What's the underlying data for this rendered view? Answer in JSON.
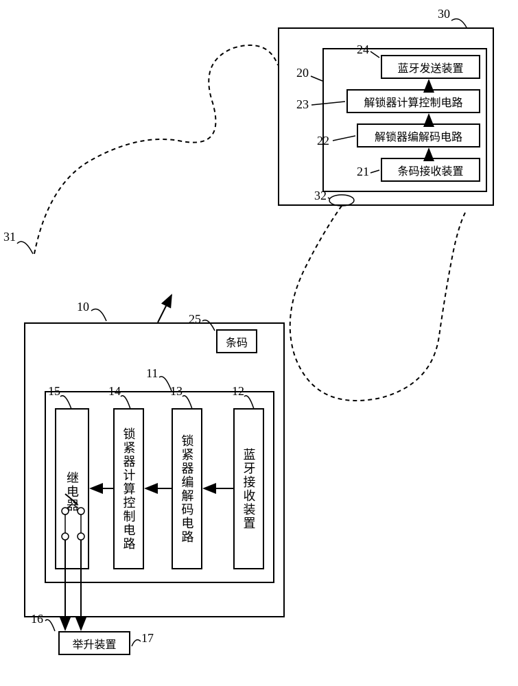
{
  "diagram": {
    "topRight": {
      "outerLabel": "30",
      "innerLabel": "20",
      "box24": {
        "num": "24",
        "text": "蓝牙发送装置"
      },
      "box23": {
        "num": "23",
        "text": "解锁器计算控制电路"
      },
      "box22": {
        "num": "22",
        "text": "解锁器编解码电路"
      },
      "box21": {
        "num": "21",
        "text": "条码接收装置"
      },
      "label32": "32"
    },
    "bottomLeft": {
      "outerLabel": "10",
      "innerLabel": "11",
      "barcode": {
        "num": "25",
        "text": "条码"
      },
      "box15": {
        "num": "15",
        "text": "继电器"
      },
      "box14": {
        "num": "14",
        "text": "锁紧器计算控制电路"
      },
      "box13": {
        "num": "13",
        "text": "锁紧器编解码电路"
      },
      "box12": {
        "num": "12",
        "text": "蓝牙接收装置"
      },
      "box17": {
        "num": "17",
        "text": "举升装置"
      },
      "label16": "16"
    },
    "label31": "31"
  }
}
